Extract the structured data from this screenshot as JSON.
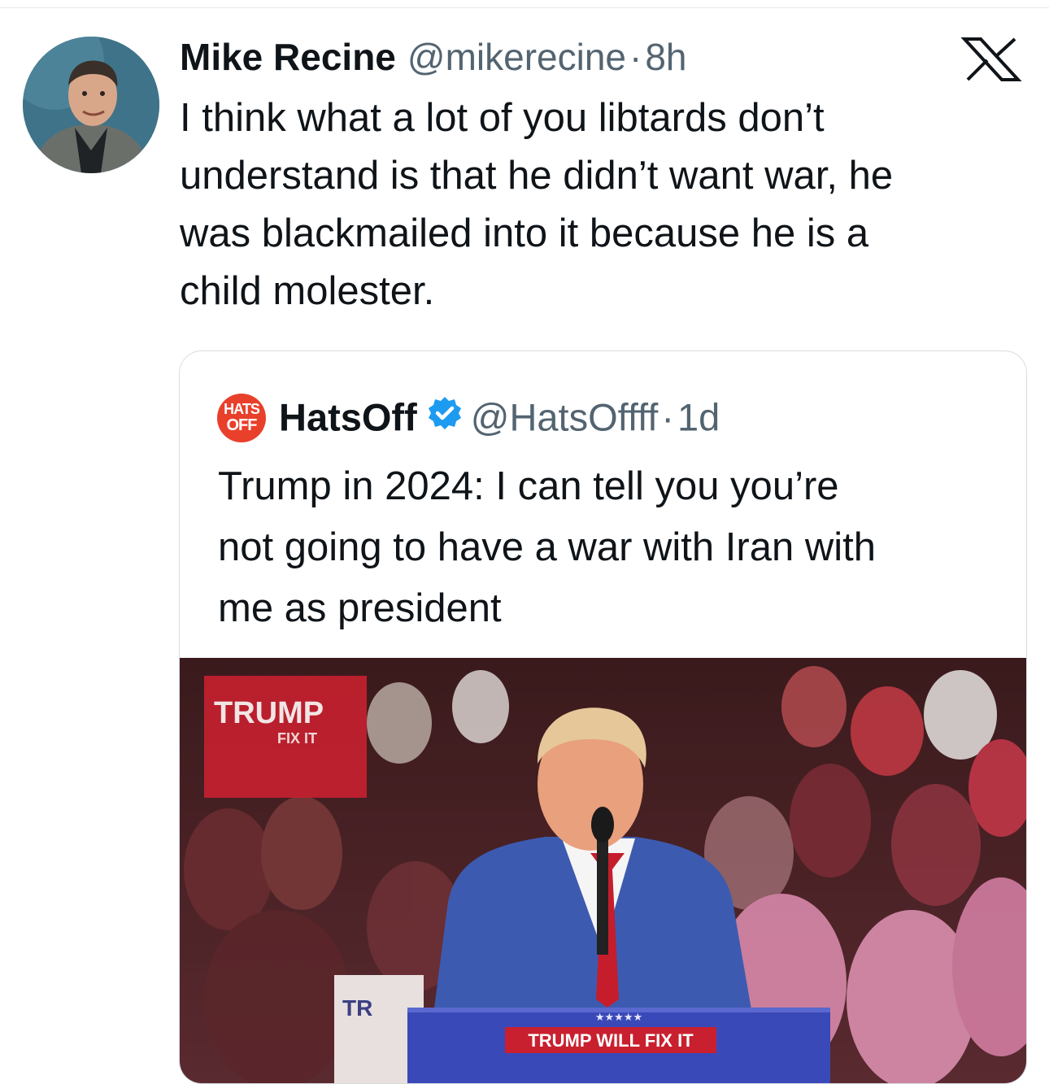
{
  "tweet": {
    "author_name": "Mike Recine",
    "handle": "@mikerecine",
    "separator": "·",
    "time": "8h",
    "text": "I think what a lot of you libtards don’t\nunderstand is that he didn’t want war, he\nwas blackmailed into it because he is a\nchild molester.",
    "avatar_icon": "profile-photo",
    "platform_icon": "x-logo-icon"
  },
  "quoted_tweet": {
    "logo_text_line1": "HATS",
    "logo_text_line2": "OFF",
    "author_name": "HatsOff",
    "verified_icon": "verified-badge-icon",
    "handle": "@HatsOffff",
    "separator": "·",
    "time": "1d",
    "text": "Trump in 2024: I can tell you you’re\nnot going to have a war with Iran with\nme as president",
    "media": {
      "sign_left": "TRUMP",
      "sign_left_sub": "FIX IT",
      "sign_small": "TR",
      "podium_stars": "★★★★★",
      "podium_text": "TRUMP WILL FIX IT"
    }
  },
  "colors": {
    "text_primary": "#0f1419",
    "text_secondary": "#536471",
    "verified_blue": "#1d9bf0",
    "hatsoff_red": "#e8402b",
    "card_border": "#d7dde2"
  }
}
